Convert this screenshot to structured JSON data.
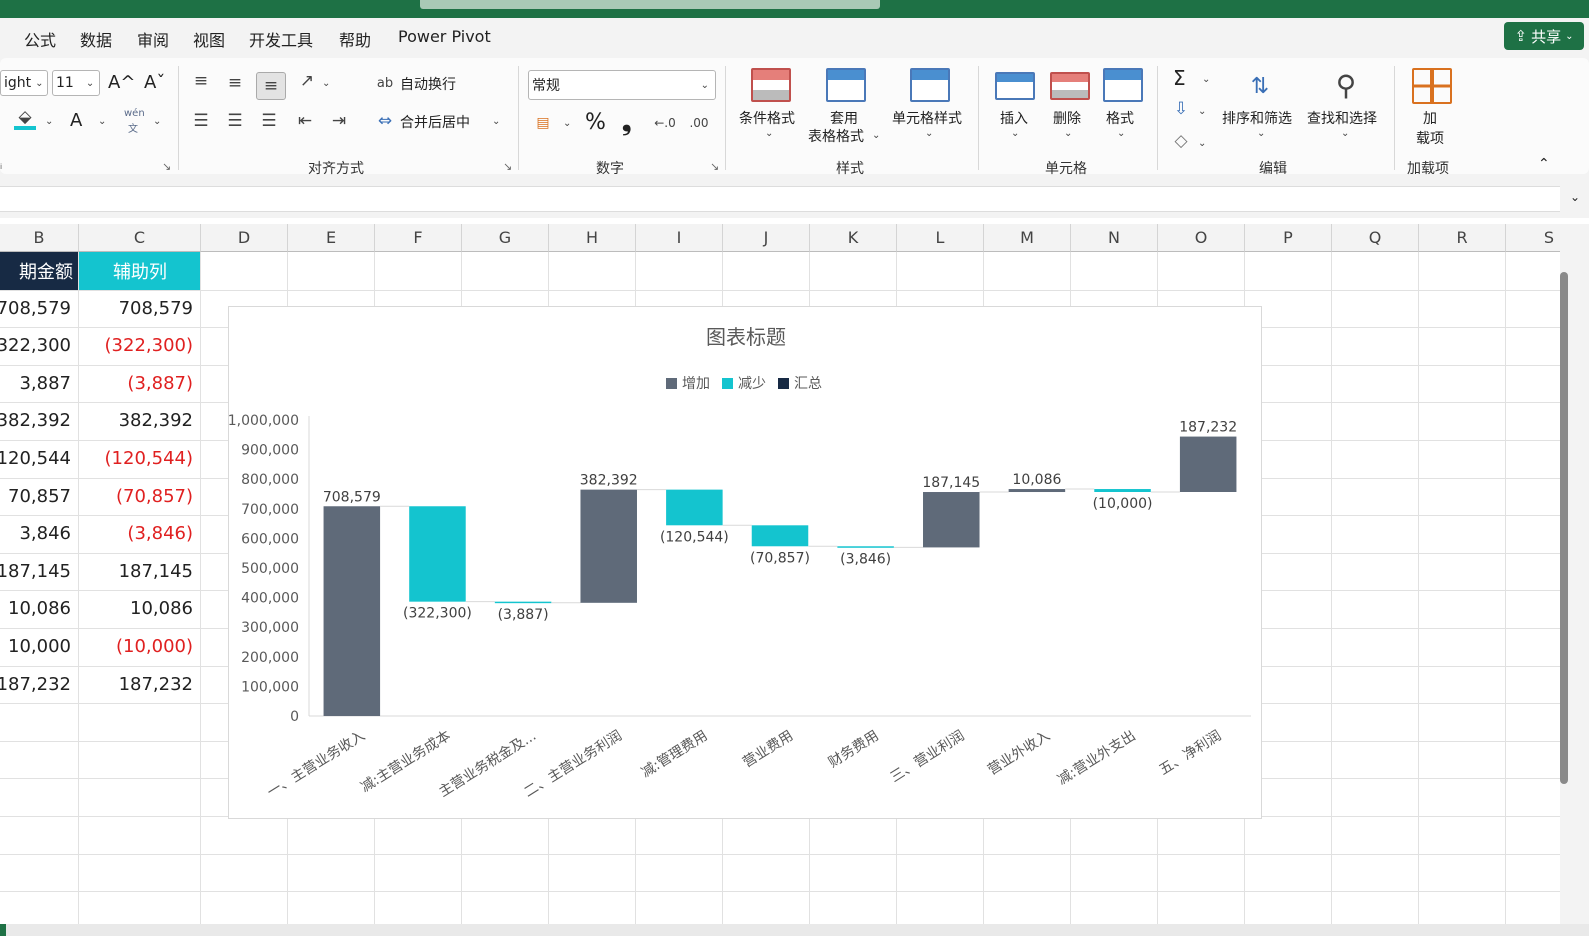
{
  "menu": {
    "tabs": [
      "公式",
      "数据",
      "审阅",
      "视图",
      "开发工具",
      "帮助",
      "Power Pivot"
    ],
    "share": "共享"
  },
  "ribbon": {
    "font_name": "ight",
    "font_size": "11",
    "grow_font": "A^",
    "shrink_font": "Aˇ",
    "font_color_letter": "A",
    "phonetic_top": "wén",
    "phonetic_bottom": "文",
    "wrap_text": "自动换行",
    "merge_center": "合并后居中",
    "number_format": "常规",
    "percent": "%",
    "comma": "❟",
    "conditional_format": "条件格式",
    "table_format_1": "套用",
    "table_format_2": "表格格式",
    "cell_styles": "单元格样式",
    "insert": "插入",
    "delete": "删除",
    "format": "格式",
    "sort_filter": "排序和筛选",
    "find_select": "查找和选择",
    "addins_1": "加",
    "addins_2": "载项",
    "groups": {
      "font_tail": "ᵢ",
      "alignment": "对齐方式",
      "number": "数字",
      "styles": "样式",
      "cells": "单元格",
      "editing": "编辑",
      "addins": "加载项"
    },
    "sum_symbol": "Σ"
  },
  "columns": [
    "B",
    "C",
    "D",
    "E",
    "F",
    "G",
    "H",
    "I",
    "J",
    "K",
    "L",
    "M",
    "N",
    "O",
    "P",
    "Q",
    "R",
    "S"
  ],
  "table": {
    "header_b": "期金额",
    "header_c": "辅助列",
    "rows": [
      {
        "b": "708,579",
        "c": "708,579",
        "neg": false
      },
      {
        "b": "322,300",
        "c": "(322,300)",
        "neg": true
      },
      {
        "b": "3,887",
        "c": "(3,887)",
        "neg": true
      },
      {
        "b": "382,392",
        "c": "382,392",
        "neg": false
      },
      {
        "b": "120,544",
        "c": "(120,544)",
        "neg": true
      },
      {
        "b": "70,857",
        "c": "(70,857)",
        "neg": true
      },
      {
        "b": "3,846",
        "c": "(3,846)",
        "neg": true
      },
      {
        "b": "187,145",
        "c": "187,145",
        "neg": false
      },
      {
        "b": "10,086",
        "c": "10,086",
        "neg": false
      },
      {
        "b": "10,000",
        "c": "(10,000)",
        "neg": true
      },
      {
        "b": "187,232",
        "c": "187,232",
        "neg": false
      }
    ]
  },
  "chart_data": {
    "type": "bar",
    "subtype": "waterfall",
    "title": "图表标题",
    "legend": [
      {
        "name": "增加",
        "color": "#5f6a79"
      },
      {
        "name": "减少",
        "color": "#14c4cf"
      },
      {
        "name": "汇总",
        "color": "#172a44"
      }
    ],
    "legend_position": "top",
    "categories": [
      "一、主营业务收入",
      "减:主营业务成本",
      "主营业务税金及...",
      "二、主营业务利润",
      "减:管理费用",
      "营业费用",
      "财务费用",
      "三、营业利润",
      "营业外收入",
      "减:营业外支出",
      "五、净利润"
    ],
    "points": [
      {
        "base": 0,
        "top": 708579,
        "kind": "increase",
        "label": "708,579"
      },
      {
        "base": 386279,
        "top": 708579,
        "kind": "decrease",
        "label": "(322,300)"
      },
      {
        "base": 382392,
        "top": 386279,
        "kind": "decrease",
        "label": "(3,887)"
      },
      {
        "base": 382392,
        "top": 764784,
        "kind": "increase",
        "label": "382,392"
      },
      {
        "base": 644240,
        "top": 764784,
        "kind": "decrease",
        "label": "(120,544)"
      },
      {
        "base": 573383,
        "top": 644240,
        "kind": "decrease",
        "label": "(70,857)"
      },
      {
        "base": 569537,
        "top": 573383,
        "kind": "decrease",
        "label": "(3,846)"
      },
      {
        "base": 569537,
        "top": 756682,
        "kind": "increase",
        "label": "187,145"
      },
      {
        "base": 756682,
        "top": 766768,
        "kind": "increase",
        "label": "10,086"
      },
      {
        "base": 756768,
        "top": 766768,
        "kind": "decrease",
        "label": "(10,000)"
      },
      {
        "base": 756768,
        "top": 944000,
        "kind": "increase",
        "label": "187,232"
      }
    ],
    "y_ticks": [
      "0",
      "100,000",
      "200,000",
      "300,000",
      "400,000",
      "500,000",
      "600,000",
      "700,000",
      "800,000",
      "900,000",
      "1,000,000"
    ],
    "ylim": [
      0,
      1000000
    ],
    "grid": false
  }
}
